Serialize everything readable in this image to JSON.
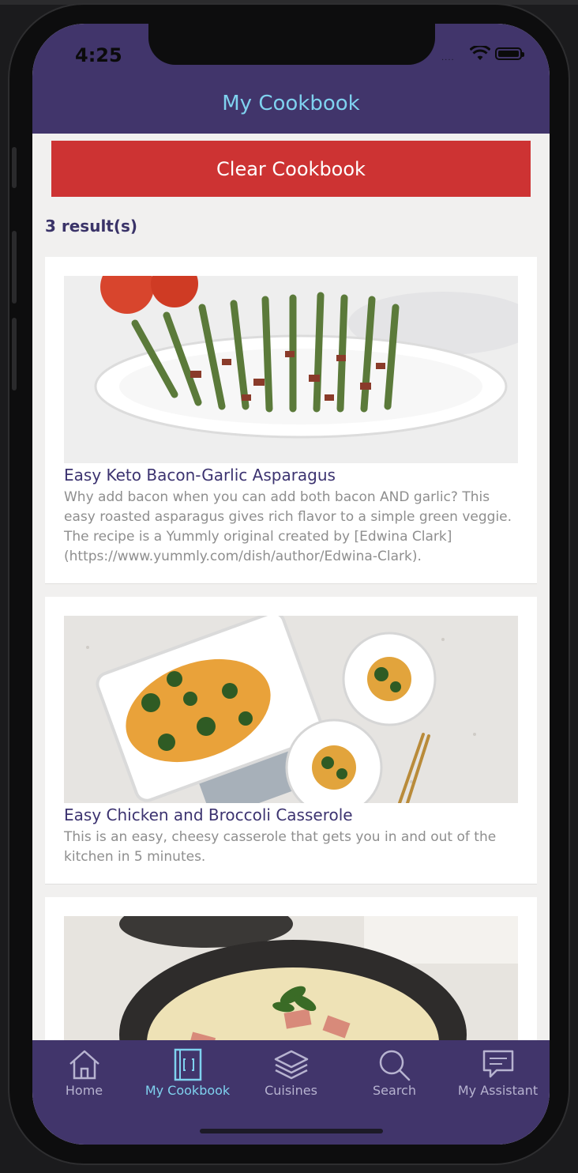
{
  "status_bar": {
    "time": "4:25",
    "signal": "....",
    "icons": [
      "wifi-icon",
      "battery-icon"
    ]
  },
  "header": {
    "title": "My Cookbook"
  },
  "actions": {
    "clear_label": "Clear Cookbook"
  },
  "results": {
    "count_label": "3 result(s)"
  },
  "recipes": [
    {
      "title": "Easy Keto Bacon-Garlic Asparagus",
      "description": "Why add bacon when you can add both bacon AND garlic? This easy roasted asparagus gives rich flavor to a simple green veggie. The recipe is a Yummly original created by [Edwina Clark](https://www.yummly.com/dish/author/Edwina-Clark).",
      "image": "asparagus-photo"
    },
    {
      "title": "Easy Chicken and Broccoli Casserole",
      "description": "This is an easy, cheesy casserole that gets you in and out of the kitchen in 5 minutes.",
      "image": "casserole-photo"
    },
    {
      "title": "",
      "description": "",
      "image": "ham-pasta-photo"
    }
  ],
  "tab_bar": {
    "items": [
      {
        "label": "Home",
        "icon": "home-icon",
        "active": false
      },
      {
        "label": "My Cookbook",
        "icon": "cookbook-icon",
        "active": true
      },
      {
        "label": "Cuisines",
        "icon": "layers-icon",
        "active": false
      },
      {
        "label": "Search",
        "icon": "search-icon",
        "active": false
      },
      {
        "label": "My Assistant",
        "icon": "chat-icon",
        "active": false
      }
    ]
  },
  "colors": {
    "header_bg": "#41356b",
    "title": "#7fd2ef",
    "clear_button": "#cd3333",
    "recipe_title": "#3c3370",
    "active_tab": "#7fd2ef"
  }
}
